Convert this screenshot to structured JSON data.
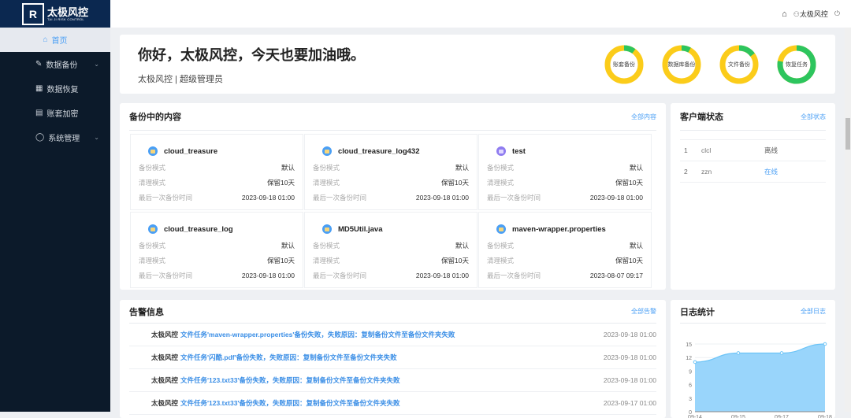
{
  "logo": {
    "name": "太极风控",
    "sub": "TAI JI RISK CONTROL"
  },
  "sidebar": {
    "items": [
      {
        "label": "首页",
        "icon": "home-icon"
      },
      {
        "label": "数据备份",
        "icon": "edit-icon"
      },
      {
        "label": "数据恢复",
        "icon": "grid-icon"
      },
      {
        "label": "账套加密",
        "icon": "document-icon"
      },
      {
        "label": "系统管理",
        "icon": "check-circle-icon"
      }
    ]
  },
  "header": {
    "user": "太极风控"
  },
  "welcome": {
    "greeting": "你好，太极风控，今天也要加油哦。",
    "role": "太极风控 | 超级管理员",
    "donuts": [
      {
        "label": "账套备份",
        "green_fraction": 0.1
      },
      {
        "label": "数据库备份",
        "green_fraction": 0.08
      },
      {
        "label": "文件备份",
        "green_fraction": 0.15
      },
      {
        "label": "恢复任务",
        "green_fraction": 0.78
      }
    ],
    "colors": {
      "green": "#2dc55e",
      "yellow": "#fbcc1a"
    }
  },
  "backup": {
    "title": "备份中的内容",
    "more": "全部内容",
    "labels": {
      "mode": "备份模式",
      "clean": "清理模式",
      "last": "最后一次备份时间"
    },
    "items": [
      {
        "name": "cloud_treasure",
        "mode": "默认",
        "clean": "保留10天",
        "last": "2023-09-18 01:00"
      },
      {
        "name": "cloud_treasure_log432",
        "mode": "默认",
        "clean": "保留10天",
        "last": "2023-09-18 01:00"
      },
      {
        "name": "test",
        "mode": "默认",
        "clean": "保留10天",
        "last": "2023-09-18 01:00"
      },
      {
        "name": "cloud_treasure_log",
        "mode": "默认",
        "clean": "保留10天",
        "last": "2023-09-18 01:00"
      },
      {
        "name": "MD5Util.java",
        "mode": "默认",
        "clean": "保留10天",
        "last": "2023-09-18 01:00"
      },
      {
        "name": "maven-wrapper.properties",
        "mode": "默认",
        "clean": "保留10天",
        "last": "2023-08-07 09:17"
      }
    ]
  },
  "clients": {
    "title": "客户端状态",
    "more": "全部状态",
    "rows": [
      {
        "no": "1",
        "name": "clcl",
        "status": "离线"
      },
      {
        "no": "2",
        "name": "zzn",
        "status": "在线"
      }
    ]
  },
  "alerts": {
    "title": "告警信息",
    "more": "全部告警",
    "rows": [
      {
        "who": "太极风控",
        "msg": "文件任务'maven-wrapper.properties'备份失败，失败原因：复制备份文件至备份文件夹失败",
        "time": "2023-09-18 01:00"
      },
      {
        "who": "太极风控",
        "msg": "文件任务'闪酷.pdf'备份失败，失败原因：复制备份文件至备份文件夹失败",
        "time": "2023-09-18 01:00"
      },
      {
        "who": "太极风控",
        "msg": "文件任务'123.txt33'备份失败，失败原因：复制备份文件至备份文件夹失败",
        "time": "2023-09-18 01:00"
      },
      {
        "who": "太极风控",
        "msg": "文件任务'123.txt33'备份失败，失败原因：复制备份文件至备份文件夹失败",
        "time": "2023-09-17 01:00"
      }
    ]
  },
  "logs": {
    "title": "日志统计",
    "more": "全部日志"
  },
  "chart_data": {
    "type": "area",
    "categories": [
      "09-14",
      "09-15",
      "09-17",
      "09-18"
    ],
    "values": [
      11,
      13,
      13,
      15
    ],
    "yticks": [
      0,
      3,
      6,
      9,
      12,
      15
    ],
    "ylim": [
      0,
      15
    ],
    "color": "#99d5fb"
  }
}
